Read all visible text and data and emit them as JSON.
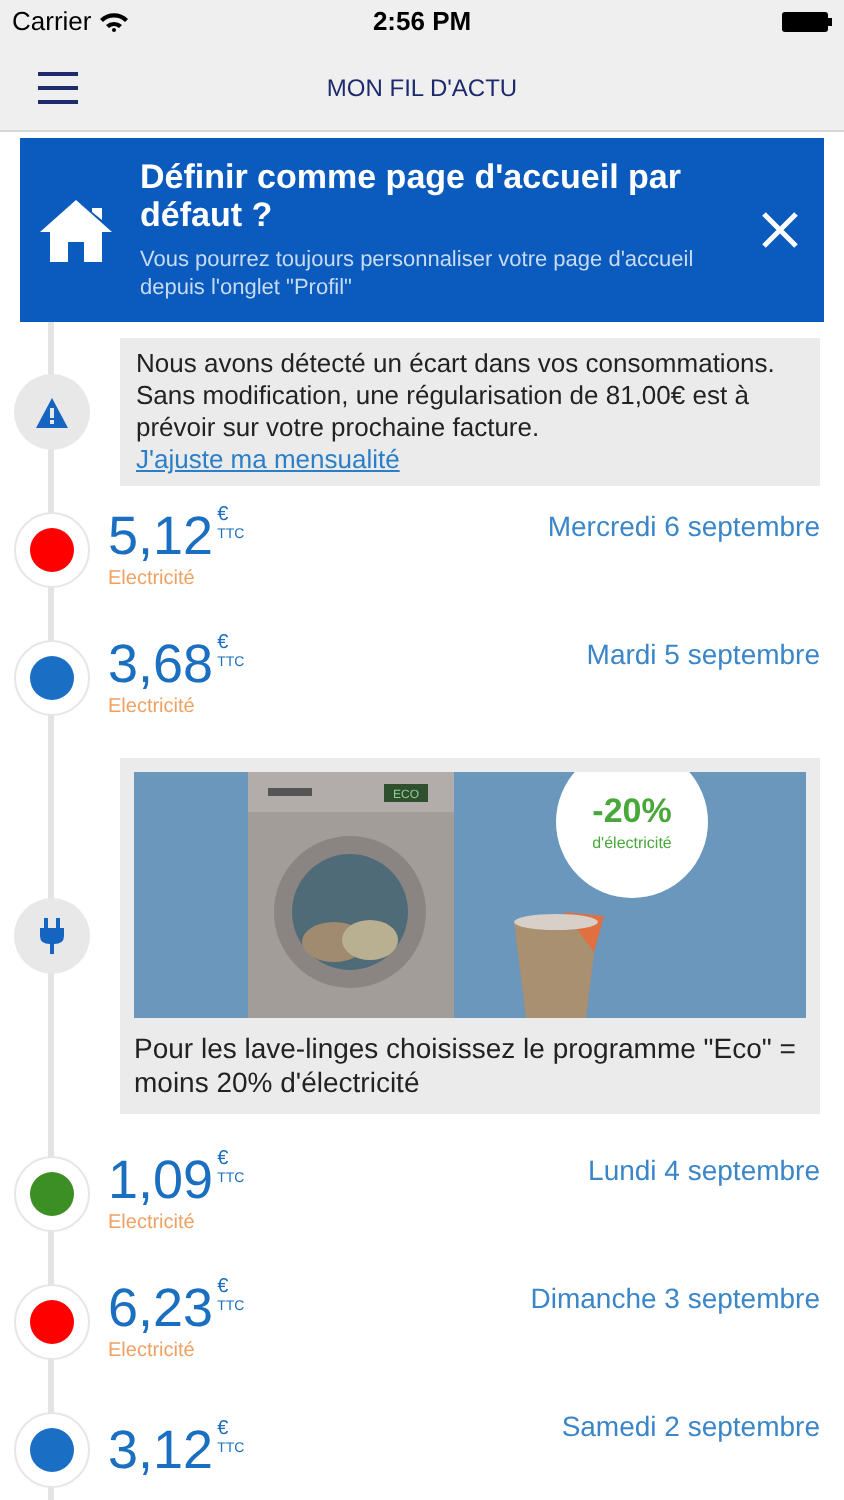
{
  "status_bar": {
    "carrier": "Carrier",
    "time": "2:56 PM"
  },
  "nav_bar": {
    "title": "MON FIL D'ACTU"
  },
  "banner": {
    "title": "Définir comme page d'accueil par défaut ?",
    "subtitle": "Vous pourrez toujours personnaliser votre page d'accueil depuis l'onglet \"Profil\""
  },
  "feed": [
    {
      "kind": "alert",
      "text": "Nous avons détecté un écart dans vos consommations. Sans modification, une régularisation de 81,00€ est à prévoir sur votre prochaine facture.",
      "link": "J'ajuste ma mensualité"
    },
    {
      "kind": "consumption",
      "amount": "5,12",
      "currency": "€",
      "tax": "TTC",
      "energy": "Electricité",
      "date": "Mercredi 6 septembre",
      "color": "#ff0000"
    },
    {
      "kind": "consumption",
      "amount": "3,68",
      "currency": "€",
      "tax": "TTC",
      "energy": "Electricité",
      "date": "Mardi 5 septembre",
      "color": "#1a6fc4"
    },
    {
      "kind": "tip",
      "badge_value": "-20%",
      "badge_label": "d'électricité",
      "text": "Pour les lave-linges choisissez le programme \"Eco\" = moins 20% d'électricité",
      "machine_label": "ECO"
    },
    {
      "kind": "consumption",
      "amount": "1,09",
      "currency": "€",
      "tax": "TTC",
      "energy": "Electricité",
      "date": "Lundi 4 septembre",
      "color": "#3b8f24"
    },
    {
      "kind": "consumption",
      "amount": "6,23",
      "currency": "€",
      "tax": "TTC",
      "energy": "Electricité",
      "date": "Dimanche 3 septembre",
      "color": "#ff0000"
    },
    {
      "kind": "consumption",
      "amount": "3,12",
      "currency": "€",
      "tax": "TTC",
      "date": "Samedi 2 septembre",
      "color": "#1a6fc4"
    }
  ]
}
